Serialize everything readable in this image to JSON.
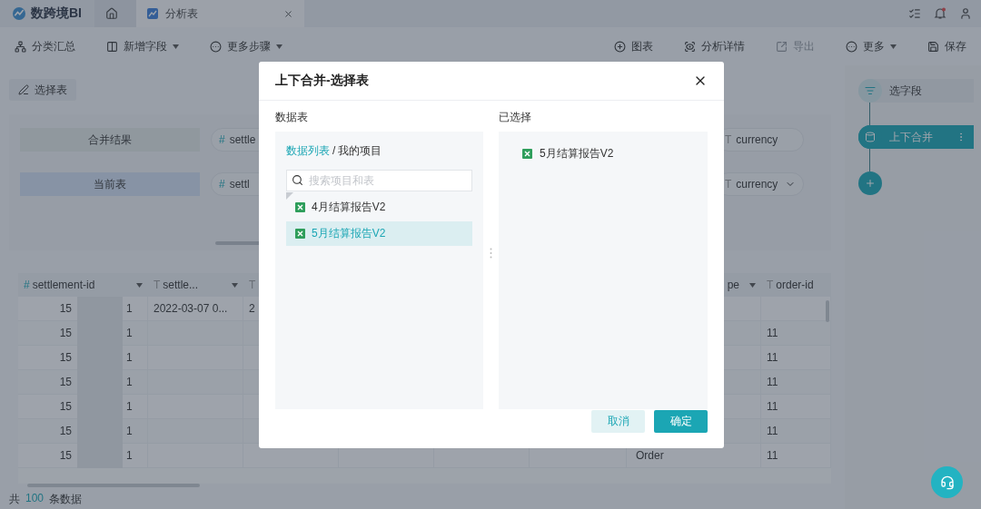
{
  "app": {
    "name": "数跨境BI"
  },
  "tabs": [
    {
      "kind": "home",
      "selected": false
    },
    {
      "kind": "sheet",
      "label": "分析表",
      "selected": true
    }
  ],
  "toolbar": {
    "left": [
      {
        "label": "分类汇总",
        "dropdown": false
      },
      {
        "label": "新增字段",
        "dropdown": true
      },
      {
        "label": "更多步骤",
        "dropdown": true
      }
    ],
    "right": [
      {
        "label": "图表",
        "dropdown": false,
        "disabled": false
      },
      {
        "label": "分析详情",
        "dropdown": false,
        "disabled": false
      },
      {
        "label": "导出",
        "dropdown": false,
        "disabled": true
      },
      {
        "label": "更多",
        "dropdown": true,
        "disabled": false
      },
      {
        "label": "保存",
        "dropdown": false,
        "disabled": false
      }
    ]
  },
  "select_table_button": {
    "label": "选择表"
  },
  "merge": {
    "rows": [
      {
        "label": "合并结果",
        "kind": "result",
        "fields": [
          {
            "glyph": "#",
            "kind": "number",
            "name": "settle"
          },
          {
            "glyph": "T",
            "kind": "text",
            "name": "currency",
            "dropdown": false
          }
        ]
      },
      {
        "label": "当前表",
        "kind": "current",
        "fields": [
          {
            "glyph": "#",
            "kind": "number",
            "name": "settl"
          },
          {
            "glyph": "T",
            "kind": "text",
            "name": "currency",
            "dropdown": true
          }
        ]
      }
    ]
  },
  "table": {
    "columns": [
      {
        "glyph": "#",
        "kind": "number",
        "label": "settlement-id"
      },
      {
        "glyph": "T",
        "kind": "text",
        "label": "settle..."
      },
      {
        "glyph": "T",
        "kind": "text"
      },
      {
        "kind": "blank"
      },
      {
        "kind": "blank"
      },
      {
        "kind": "blank"
      },
      {
        "kind": "text",
        "label": "pe"
      },
      {
        "glyph": "T",
        "kind": "text",
        "label": "order-id"
      }
    ],
    "rows": [
      [
        [
          "15",
          "1"
        ],
        "2022-03-07 0...",
        "2",
        null,
        null,
        null,
        null,
        null
      ],
      [
        [
          "15",
          "1"
        ],
        null,
        null,
        null,
        null,
        null,
        null,
        "11"
      ],
      [
        [
          "15",
          "1"
        ],
        null,
        null,
        null,
        null,
        null,
        null,
        "11"
      ],
      [
        [
          "15",
          "1"
        ],
        null,
        null,
        null,
        null,
        null,
        null,
        "11"
      ],
      [
        [
          "15",
          "1"
        ],
        null,
        null,
        null,
        null,
        null,
        null,
        "11"
      ],
      [
        [
          "15",
          "1"
        ],
        null,
        null,
        null,
        null,
        null,
        null,
        "11"
      ],
      [
        [
          "15",
          "1"
        ],
        null,
        null,
        null,
        null,
        null,
        "Order",
        "11"
      ]
    ]
  },
  "footer": {
    "prefix": "共",
    "count": "100",
    "suffix": "条数据"
  },
  "flow": {
    "nodes": [
      {
        "label": "选字段",
        "selected": false
      },
      {
        "label": "上下合并",
        "selected": true
      }
    ]
  },
  "dialog": {
    "title": "上下合并-选择表",
    "left": {
      "heading": "数据表",
      "breadcrumb": [
        {
          "label": "数据列表",
          "link": true
        },
        {
          "label": "我的项目",
          "link": false
        }
      ],
      "separator": "/",
      "search": {
        "placeholder": "搜索项目和表"
      },
      "items": [
        {
          "label": "4月结算报告V2",
          "selected": false,
          "marked": true
        },
        {
          "label": "5月结算报告V2",
          "selected": true,
          "marked": false
        }
      ]
    },
    "right": {
      "heading": "已选择",
      "items": [
        {
          "label": "5月结算报告V2"
        }
      ]
    },
    "buttons": [
      {
        "label": "取消",
        "kind": "secondary"
      },
      {
        "label": "确定",
        "kind": "primary"
      }
    ]
  }
}
